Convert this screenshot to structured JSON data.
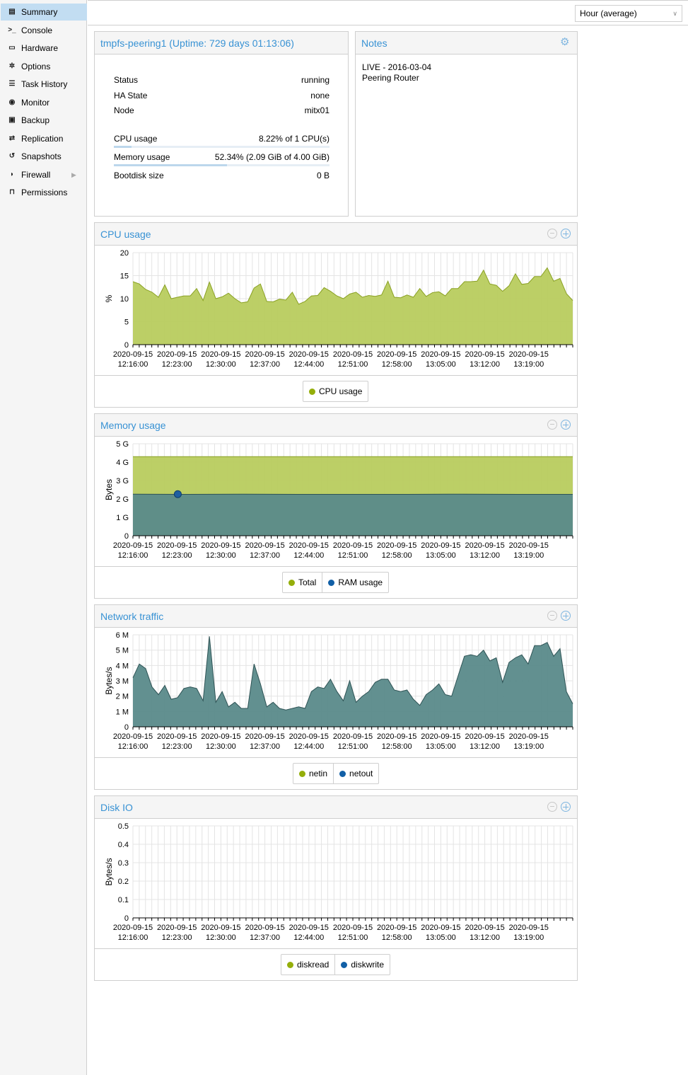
{
  "sidebar": {
    "items": [
      {
        "label": "Summary",
        "icon": "book-icon",
        "glyph": "▤",
        "active": true
      },
      {
        "label": "Console",
        "icon": "terminal-icon",
        "glyph": ">_",
        "active": false
      },
      {
        "label": "Hardware",
        "icon": "desktop-icon",
        "glyph": "▭",
        "active": false
      },
      {
        "label": "Options",
        "icon": "gear-icon",
        "glyph": "✲",
        "active": false
      },
      {
        "label": "Task History",
        "icon": "list-icon",
        "glyph": "☰",
        "active": false
      },
      {
        "label": "Monitor",
        "icon": "eye-icon",
        "glyph": "◉",
        "active": false
      },
      {
        "label": "Backup",
        "icon": "floppy-icon",
        "glyph": "▣",
        "active": false
      },
      {
        "label": "Replication",
        "icon": "retweet-icon",
        "glyph": "⇄",
        "active": false
      },
      {
        "label": "Snapshots",
        "icon": "history-icon",
        "glyph": "↺",
        "active": false
      },
      {
        "label": "Firewall",
        "icon": "shield-icon",
        "glyph": "◗",
        "active": false,
        "has_arrow": true
      },
      {
        "label": "Permissions",
        "icon": "unlock-icon",
        "glyph": "⊓",
        "active": false
      }
    ]
  },
  "toolbar": {
    "timeframe": "Hour (average)"
  },
  "status_panel": {
    "title": "tmpfs-peering1 (Uptime: 729 days 01:13:06)",
    "rows": {
      "status": {
        "label": "Status",
        "value": "running"
      },
      "ha": {
        "label": "HA State",
        "value": "none"
      },
      "node": {
        "label": "Node",
        "value": "mitx01"
      },
      "cpu": {
        "label": "CPU usage",
        "value": "8.22% of 1 CPU(s)",
        "fraction": 0.0822
      },
      "mem": {
        "label": "Memory usage",
        "value": "52.34% (2.09 GiB of 4.00 GiB)",
        "fraction": 0.5234
      },
      "disk": {
        "label": "Bootdisk size",
        "value": "0 B"
      }
    }
  },
  "notes_panel": {
    "title": "Notes",
    "text": "LIVE - 2016-03-04\nPeering Router"
  },
  "colors": {
    "green": "#b8cc5e",
    "green_line": "#8aa123",
    "teal": "#5a8a8a",
    "teal_line": "#2e5355",
    "blue": "#1f5fa0",
    "legend_green": "#94ae0a",
    "legend_blue": "#115fa6",
    "title_blue": "#3892d4"
  },
  "chart_data": [
    {
      "type": "area",
      "title": "CPU usage",
      "ylabel": "%",
      "ylim": [
        0,
        20
      ],
      "yticks": [
        "0",
        "5",
        "10",
        "15",
        "20"
      ],
      "xticks": [
        "12:16:00",
        "12:23:00",
        "12:30:00",
        "12:37:00",
        "12:44:00",
        "12:51:00",
        "12:58:00",
        "13:05:00",
        "13:12:00",
        "13:19:00"
      ],
      "xdate": "2020-09-15",
      "series": [
        {
          "name": "CPU usage",
          "color": "#b8cc5e",
          "line": "#8aa123",
          "legend": "#94ae0a",
          "values": [
            13.7,
            13.2,
            12,
            11.4,
            10.3,
            13,
            10,
            10.3,
            10.6,
            10.6,
            12.2,
            9.6,
            13.6,
            10,
            10.4,
            11.2,
            10,
            9.1,
            9.3,
            12.3,
            13.2,
            9.4,
            9.3,
            9.9,
            9.7,
            11.4,
            8.8,
            9.4,
            10.6,
            10.7,
            12.4,
            11.6,
            10.6,
            10,
            11,
            11.4,
            10.3,
            10.7,
            10.5,
            10.8,
            13.8,
            10.3,
            10.2,
            10.8,
            10.3,
            12.2,
            10.5,
            11.3,
            11.5,
            10.6,
            12.2,
            12.2,
            13.7,
            13.7,
            13.8,
            16.2,
            13.2,
            12.9,
            11.6,
            12.8,
            15.4,
            13.1,
            13.3,
            14.8,
            14.8,
            16.7,
            13.8,
            14.4,
            11.1,
            9.6
          ]
        }
      ]
    },
    {
      "type": "area",
      "title": "Memory usage",
      "ylabel": "Bytes",
      "ylim": [
        0,
        5
      ],
      "yticks": [
        "0",
        "1 G",
        "2 G",
        "3 G",
        "4 G",
        "5 G"
      ],
      "xticks": [
        "12:16:00",
        "12:23:00",
        "12:30:00",
        "12:37:00",
        "12:44:00",
        "12:51:00",
        "12:58:00",
        "13:05:00",
        "13:12:00",
        "13:19:00"
      ],
      "xdate": "2020-09-15",
      "series": [
        {
          "name": "Total",
          "color": "#b8cc5e",
          "line": "#8aa123",
          "legend": "#94ae0a",
          "values": [
            4.3,
            4.3
          ]
        },
        {
          "name": "RAM usage",
          "color": "#5a8a8a",
          "line": "#2e5355",
          "legend": "#115fa6",
          "values": [
            2.26,
            2.25,
            2.26,
            2.25,
            2.25,
            2.25,
            2.26,
            2.25,
            2.25
          ]
        }
      ],
      "marker": {
        "series": "RAM usage",
        "x_index": 1,
        "value": 2.26
      }
    },
    {
      "type": "area",
      "title": "Network traffic",
      "ylabel": "Bytes/s",
      "ylim": [
        0,
        6
      ],
      "yticks": [
        "0",
        "1 M",
        "2 M",
        "3 M",
        "4 M",
        "5 M",
        "6 M"
      ],
      "xticks": [
        "12:16:00",
        "12:23:00",
        "12:30:00",
        "12:37:00",
        "12:44:00",
        "12:51:00",
        "12:58:00",
        "13:05:00",
        "13:12:00",
        "13:19:00"
      ],
      "xdate": "2020-09-15",
      "series": [
        {
          "name": "netin",
          "color": "#b8cc5e",
          "line": "#8aa123",
          "legend": "#94ae0a",
          "values": []
        },
        {
          "name": "netout",
          "color": "#5a8a8a",
          "line": "#2e5355",
          "legend": "#115fa6",
          "values": [
            3.2,
            4.1,
            3.8,
            2.6,
            2.1,
            2.7,
            1.8,
            1.9,
            2.5,
            2.6,
            2.5,
            1.7,
            5.9,
            1.6,
            2.3,
            1.3,
            1.6,
            1.2,
            1.2,
            4.1,
            2.8,
            1.3,
            1.6,
            1.2,
            1.1,
            1.2,
            1.3,
            1.2,
            2.3,
            2.6,
            2.5,
            3.1,
            2.3,
            1.7,
            3.0,
            1.6,
            2.0,
            2.3,
            2.9,
            3.1,
            3.1,
            2.4,
            2.3,
            2.4,
            1.8,
            1.4,
            2.1,
            2.4,
            2.8,
            2.1,
            2.0,
            3.3,
            4.6,
            4.7,
            4.6,
            5.0,
            4.3,
            4.5,
            2.9,
            4.2,
            4.5,
            4.7,
            4.1,
            5.3,
            5.3,
            5.5,
            4.6,
            5.1,
            2.3,
            1.5
          ]
        }
      ]
    },
    {
      "type": "area",
      "title": "Disk IO",
      "ylabel": "Bytes/s",
      "ylim": [
        0,
        0.5
      ],
      "yticks": [
        "0",
        "0.1",
        "0.2",
        "0.3",
        "0.4",
        "0.5"
      ],
      "xticks": [
        "12:16:00",
        "12:23:00",
        "12:30:00",
        "12:37:00",
        "12:44:00",
        "12:51:00",
        "12:58:00",
        "13:05:00",
        "13:12:00",
        "13:19:00"
      ],
      "xdate": "2020-09-15",
      "series": [
        {
          "name": "diskread",
          "color": "#b8cc5e",
          "line": "#8aa123",
          "legend": "#94ae0a",
          "values": []
        },
        {
          "name": "diskwrite",
          "color": "#5a8a8a",
          "line": "#2e5355",
          "legend": "#115fa6",
          "values": []
        }
      ]
    }
  ]
}
